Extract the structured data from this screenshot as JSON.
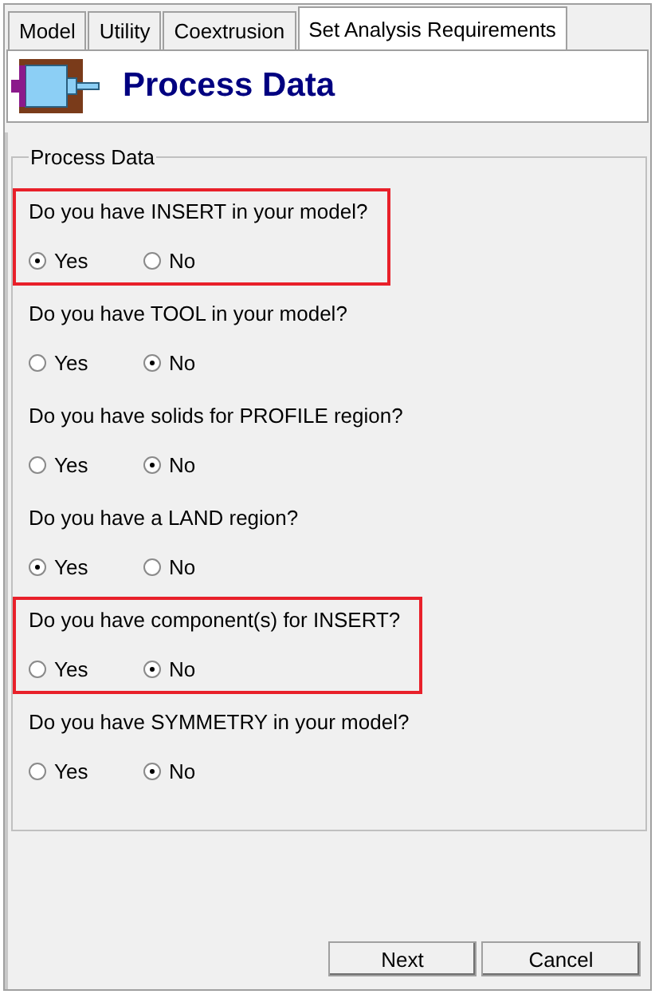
{
  "tabs": [
    {
      "label": "Model",
      "selected": false
    },
    {
      "label": "Utility",
      "selected": false
    },
    {
      "label": "Coextrusion",
      "selected": false
    },
    {
      "label": "Set Analysis Requirements",
      "selected": true
    }
  ],
  "header": {
    "title": "Process Data"
  },
  "group": {
    "title": "Process Data",
    "questions": [
      {
        "text": "Do you have INSERT in your model?",
        "highlighted": true,
        "options": [
          {
            "label": "Yes",
            "selected": true
          },
          {
            "label": "No",
            "selected": false
          }
        ]
      },
      {
        "text": "Do you have TOOL in your model?",
        "highlighted": false,
        "options": [
          {
            "label": "Yes",
            "selected": false
          },
          {
            "label": "No",
            "selected": true
          }
        ]
      },
      {
        "text": "Do you have solids for PROFILE region?",
        "highlighted": false,
        "options": [
          {
            "label": "Yes",
            "selected": false
          },
          {
            "label": "No",
            "selected": true
          }
        ]
      },
      {
        "text": "Do you have a LAND region?",
        "highlighted": false,
        "options": [
          {
            "label": "Yes",
            "selected": true
          },
          {
            "label": "No",
            "selected": false
          }
        ]
      },
      {
        "text": "Do you have component(s) for INSERT?",
        "highlighted": true,
        "options": [
          {
            "label": "Yes",
            "selected": false
          },
          {
            "label": "No",
            "selected": true
          }
        ]
      },
      {
        "text": "Do you have SYMMETRY in your model?",
        "highlighted": false,
        "options": [
          {
            "label": "Yes",
            "selected": false
          },
          {
            "label": "No",
            "selected": true
          }
        ]
      }
    ]
  },
  "buttons": [
    "Next",
    "Cancel"
  ]
}
